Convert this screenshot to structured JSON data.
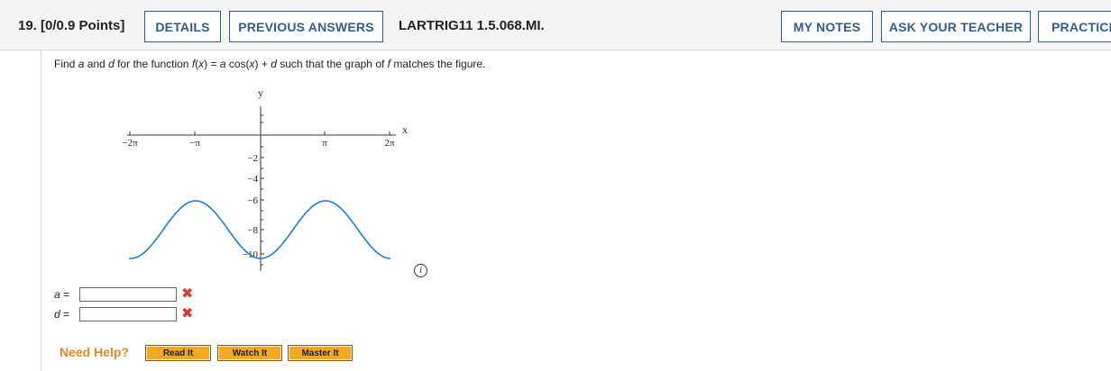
{
  "header": {
    "question_number": "19.",
    "points": "[0/0.9 Points]",
    "details_label": "DETAILS",
    "previous_answers_label": "PREVIOUS ANSWERS",
    "code": "LARTRIG11 1.5.068.MI.",
    "my_notes_label": "MY NOTES",
    "ask_teacher_label": "ASK YOUR TEACHER",
    "practice_label": "PRACTICE"
  },
  "prompt": {
    "part1": "Find ",
    "var_a": "a",
    "part2": " and ",
    "var_d": "d",
    "part3": " for the function ",
    "func_f": "f",
    "part4": "(",
    "var_x": "x",
    "part5": ") = ",
    "var_a2": "a",
    "part6": " cos(",
    "var_x2": "x",
    "part7": ") + ",
    "var_d2": "d",
    "part8": " such that the graph of ",
    "func_f2": "f",
    "part9": " matches the figure."
  },
  "graph": {
    "x_axis_label": "x",
    "y_axis_label": "y",
    "x_ticks": [
      "−2π",
      "−π",
      "π",
      "2π"
    ],
    "y_ticks": [
      "−2",
      "−4",
      "−6",
      "−8",
      "−10"
    ],
    "curve_color": "#1a7fd6",
    "info_icon": "info-icon",
    "info_glyph": "i"
  },
  "answers": {
    "a_label_var": "a",
    "a_label_eq": " =",
    "a_value": "",
    "d_label_var": "d",
    "d_label_eq": " =",
    "d_value": "",
    "status_icon": "wrong-x-icon",
    "status_glyph": "✖"
  },
  "help": {
    "label": "Need Help?",
    "read_it": "Read It",
    "watch_it": "Watch It",
    "master_it": "Master It"
  },
  "colors": {
    "button_border": "#2f5e8c",
    "help_orange": "#e08a1e",
    "help_button": "#f5a623",
    "wrong_red": "#d93636"
  }
}
